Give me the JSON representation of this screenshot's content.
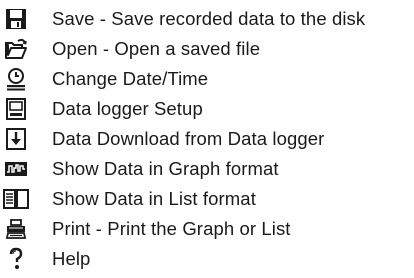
{
  "legend": {
    "items": [
      {
        "icon": "save-disk-icon",
        "label": "Save - Save recorded data to the disk"
      },
      {
        "icon": "open-folder-icon",
        "label": "Open - Open a saved file"
      },
      {
        "icon": "clock-icon",
        "label": "Change Date/Time"
      },
      {
        "icon": "logger-setup-icon",
        "label": "Data logger Setup"
      },
      {
        "icon": "download-arrow-icon",
        "label": "Data Download from Data logger"
      },
      {
        "icon": "graph-icon",
        "label": "Show Data in Graph format"
      },
      {
        "icon": "list-icon",
        "label": "Show Data in List format"
      },
      {
        "icon": "printer-icon",
        "label": "Print - Print the Graph or List"
      },
      {
        "icon": "help-icon",
        "label": "Help"
      }
    ]
  }
}
